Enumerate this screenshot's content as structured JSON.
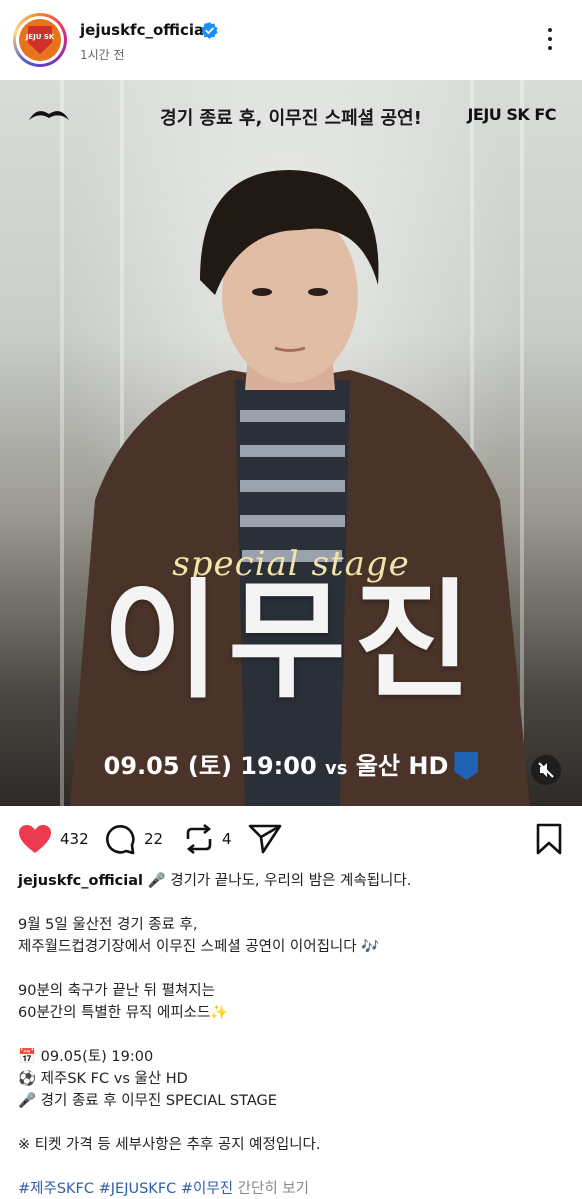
{
  "post": {
    "username": "jejuskfc_official",
    "time": "1시간 전",
    "avatar_text": "JEJU SK"
  },
  "image": {
    "headline": "경기 종료 후, 이무진 스페셜 공연!",
    "brand": "JEJU SK FC",
    "special": "special stage",
    "name": "이무진",
    "date": "09.05 (토) 19:00",
    "vs": "vs",
    "opponent": "울산 HD"
  },
  "actions": {
    "likes": "432",
    "comments": "22",
    "reposts": "4"
  },
  "caption": {
    "username": "jejuskfc_official",
    "lead": "🎤 경기가 끝나도, 우리의 밤은 계속됩니다.",
    "line1": "9월 5일 울산전 경기 종료 후,",
    "line2": "제주월드컵경기장에서 이무진 스페셜 공연이 이어집니다 🎶",
    "line3": "90분의 축구가 끝난 뒤 펼쳐지는",
    "line4": "60분간의 특별한 뮤직 에피소드✨",
    "line5": "📅 09.05(토) 19:00",
    "line6": "⚽ 제주SK FC vs 울산 HD",
    "line7": "🎤 경기 종료 후 이무진 SPECIAL STAGE",
    "line8": "※ 티켓 가격 등 세부사항은 추후 공지 예정입니다.",
    "hashtags": [
      "#제주SKFC",
      "#JEJUSKFC",
      "#이무진"
    ],
    "more": "간단히 보기"
  },
  "colors": {
    "like": "#ed3a4f",
    "verified": "#1f8ef1",
    "hashtag": "#2f5fa8"
  }
}
